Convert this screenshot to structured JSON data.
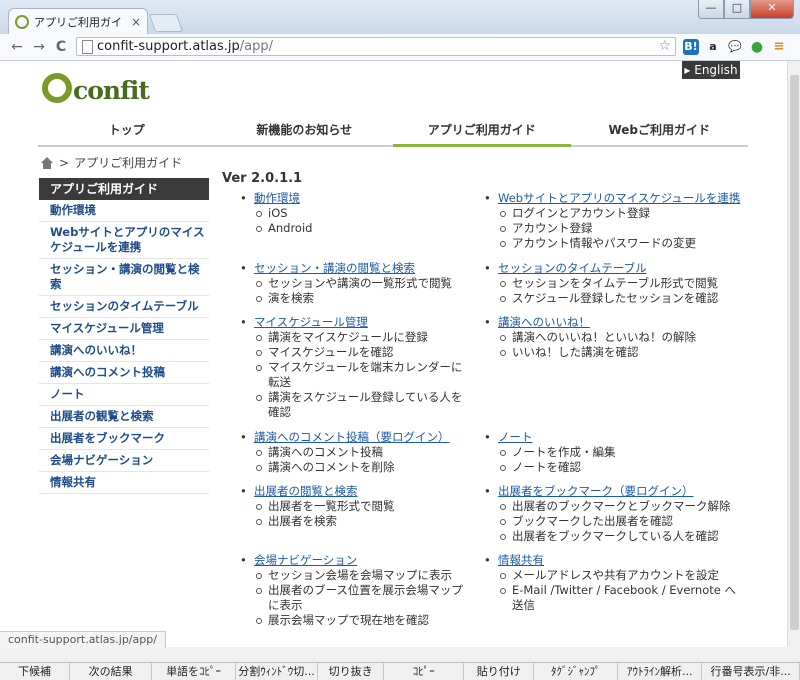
{
  "browser": {
    "tab_title": "アプリご利用ガイド - Co",
    "tab_close": "×",
    "url_host": "confit-support.atlas.jp",
    "url_path": "/app/",
    "status_url": "confit-support.atlas.jp/app/",
    "window_buttons": {
      "minimize": "—",
      "maximize": "□",
      "close": "✕"
    },
    "nav": {
      "back": "←",
      "forward": "→",
      "reload": "C"
    },
    "extensions": [
      "B!",
      "a",
      "💬",
      "●",
      "≡"
    ]
  },
  "header": {
    "logo_word": "confit",
    "english_label": "▸ English",
    "gnav": [
      {
        "label": "トップ",
        "active": false
      },
      {
        "label": "新機能のお知らせ",
        "active": false
      },
      {
        "label": "アプリご利用ガイド",
        "active": true
      },
      {
        "label": "Webご利用ガイド",
        "active": false
      }
    ]
  },
  "breadcrumb": {
    "sep": ">",
    "current": "アプリご利用ガイド"
  },
  "sidebar": {
    "heading": "アプリご利用ガイド",
    "items": [
      "動作環境",
      "Webサイトとアプリのマイスケジュールを連携",
      "セッション・講演の閲覧と検索",
      "セッションのタイムテーブル",
      "マイスケジュール管理",
      "講演へのいいね！",
      "講演へのコメント投稿",
      "ノート",
      "出展者の観覧と検索",
      "出展者をブックマーク",
      "会場ナビゲーション",
      "情報共有"
    ]
  },
  "main": {
    "version": "Ver 2.0.1.1",
    "sections": [
      {
        "title": "動作環境",
        "items": [
          "iOS",
          "Android"
        ]
      },
      {
        "title": "Webサイトとアプリのマイスケジュールを連携",
        "items": [
          "ログインとアカウント登録",
          "アカウント登録",
          "アカウント情報やパスワードの変更"
        ]
      },
      {
        "title": "セッション・講演の閲覧と検索",
        "items": [
          "セッションや講演の一覧形式で閲覧",
          "演を検索"
        ]
      },
      {
        "title": "セッションのタイムテーブル",
        "items": [
          "セッションをタイムテーブル形式で閲覧",
          "スケジュール登録したセッションを確認"
        ]
      },
      {
        "title": "マイスケジュール管理",
        "items": [
          "講演をマイスケジュールに登録",
          "マイスケジュールを確認",
          "マイスケジュールを端末カレンダーに転送",
          "講演をスケジュール登録している人を確認"
        ]
      },
      {
        "title": "講演へのいいね！",
        "items": [
          "講演へのいいね！といいね！の解除",
          "いいね！した講演を確認"
        ]
      },
      {
        "title": "講演へのコメント投稿（要ログイン）",
        "items": [
          "講演へのコメント投稿",
          "講演へのコメントを削除"
        ]
      },
      {
        "title": "ノート",
        "items": [
          "ノートを作成・編集",
          "ノートを確認"
        ]
      },
      {
        "title": "出展者の閲覧と検索",
        "items": [
          "出展者を一覧形式で閲覧",
          "出展者を検索"
        ]
      },
      {
        "title": "出展者をブックマーク（要ログイン）",
        "items": [
          "出展者のブックマークとブックマーク解除",
          "ブックマークした出展者を確認",
          "出展者をブックマークしている人を確認"
        ]
      },
      {
        "title": "会場ナビゲーション",
        "items": [
          "セッション会場を会場マップに表示",
          "出展者のブース位置を展示会場マップに表示",
          "展示会場マップで現在地を確認"
        ]
      },
      {
        "title": "情報共有",
        "items": [
          "メールアドレスや共有アカウントを設定",
          "E-Mail /Twitter / Facebook / Evernote へ送信"
        ]
      }
    ]
  },
  "taskbar": [
    "下候補",
    "次の結果",
    "単語をｺﾋﾟｰ",
    "分割ｳｨﾝﾄﾞｳ切...",
    "切り抜き",
    "ｺﾋﾟｰ",
    "貼り付け",
    "ﾀｸﾞｼﾞｬﾝﾌﾟ",
    "ｱｳﾄﾗｲﾝ解析...",
    "行番号表示/非..."
  ]
}
